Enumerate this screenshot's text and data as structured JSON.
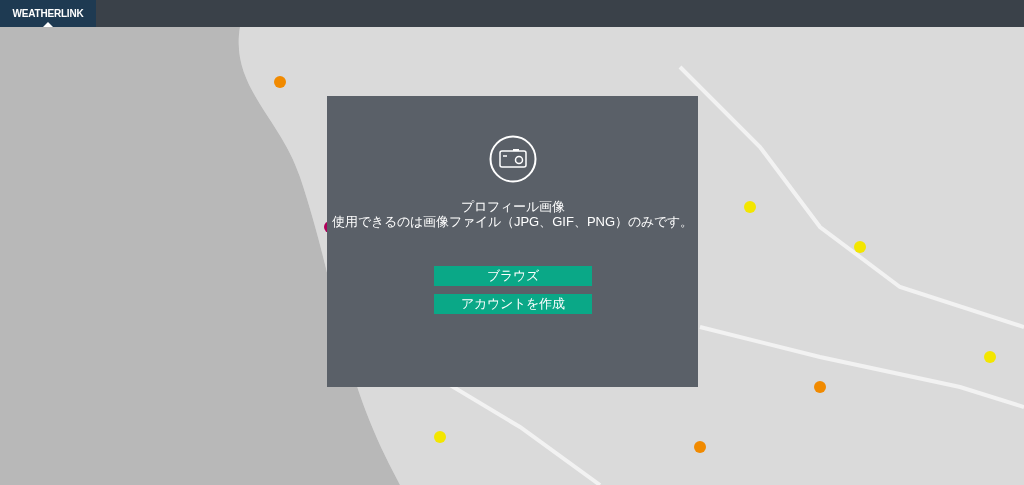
{
  "header": {
    "tabs": [
      {
        "label": "WEATHERLINK",
        "selected": true
      }
    ]
  },
  "dialog": {
    "title": "プロフィール画像",
    "message": "使用できるのは画像ファイル（JPG、GIF、PNG）のみです。",
    "buttons": [
      "ブラウズ",
      "アカウントを作成"
    ]
  }
}
